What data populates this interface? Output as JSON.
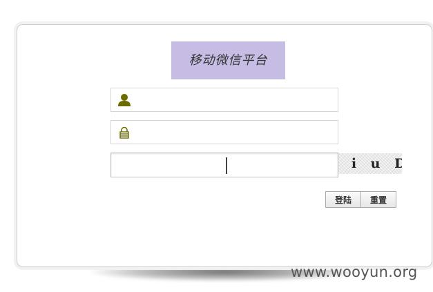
{
  "login": {
    "title": "移动微信平台",
    "username": {
      "value": "",
      "placeholder": "",
      "icon": "user-icon"
    },
    "password": {
      "value": "",
      "placeholder": "",
      "icon": "lock-icon"
    },
    "captcha": {
      "value": "",
      "placeholder": "",
      "image_text": "z i u D"
    },
    "buttons": {
      "login_label": "登陆",
      "reset_label": "重置"
    }
  },
  "watermark": "www.wooyun.org",
  "colors": {
    "title_bg": "#c7bde4",
    "icon": "#6b6b00",
    "border": "#d4d4d4"
  }
}
